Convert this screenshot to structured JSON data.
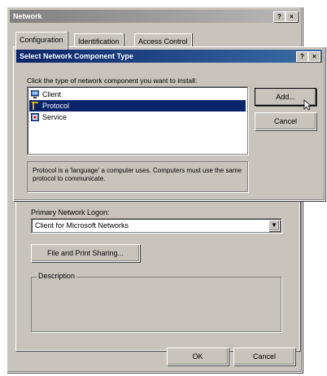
{
  "network_window": {
    "title": "Network",
    "help_btn": "?",
    "close_btn": "×",
    "tabs": [
      "Configuration",
      "Identification",
      "Access Control"
    ],
    "primary_logon_label": "Primary Network Logon:",
    "primary_logon_value": "Client for Microsoft Networks",
    "file_print_button": "File and Print Sharing...",
    "description_label": "Description",
    "ok_button": "OK",
    "cancel_button": "Cancel"
  },
  "dialog": {
    "title": "Select Network Component Type",
    "help_btn": "?",
    "close_btn": "×",
    "instruction": "Click the type of network component you want to install:",
    "items": [
      {
        "label": "Client",
        "icon": "client-icon"
      },
      {
        "label": "Protocol",
        "icon": "protocol-icon"
      },
      {
        "label": "Service",
        "icon": "service-icon"
      }
    ],
    "selected_index": 1,
    "add_button": "Add...",
    "cancel_button": "Cancel",
    "description": "Protocol is a 'language' a computer uses. Computers must use the same protocol to communicate."
  }
}
